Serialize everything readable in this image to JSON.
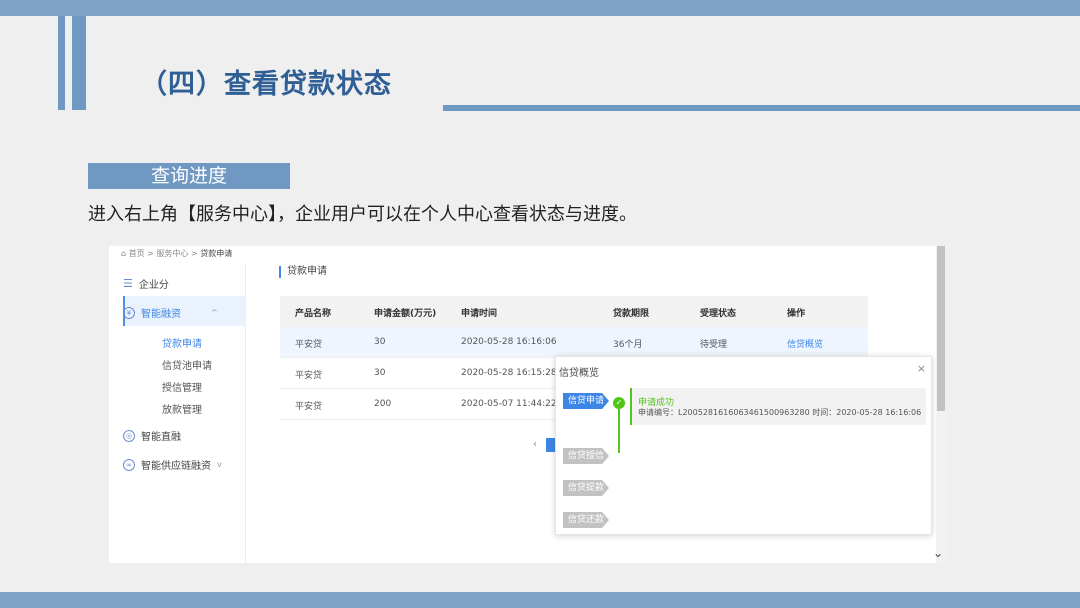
{
  "slide": {
    "title": "（四）查看贷款状态",
    "section": "查询进度",
    "description": "进入右上角【服务中心】，企业用户可以在个人中心查看状态与进度。"
  },
  "breadcrumb": {
    "home": "首页",
    "sep": ">",
    "service": "服务中心",
    "current": "贷款申请"
  },
  "sidebar": {
    "items": [
      {
        "label": "企业分"
      },
      {
        "label": "智能融资"
      },
      {
        "label": "智能直融"
      },
      {
        "label": "智能供应链融资"
      }
    ],
    "sub_items": [
      {
        "label": "贷款申请"
      },
      {
        "label": "信贷池申请"
      },
      {
        "label": "授信管理"
      },
      {
        "label": "放款管理"
      }
    ]
  },
  "panel": {
    "title": "贷款申请"
  },
  "table": {
    "headers": [
      "产品名称",
      "申请金额(万元)",
      "申请时间",
      "贷款期限",
      "受理状态",
      "操作"
    ],
    "rows": [
      [
        "平安贷",
        "30",
        "2020-05-28 16:16:06",
        "36个月",
        "待受理",
        "信贷概览"
      ],
      [
        "平安贷",
        "30",
        "2020-05-28 16:15:28",
        "",
        "",
        ""
      ],
      [
        "平安贷",
        "200",
        "2020-05-07 11:44:22",
        "",
        "",
        ""
      ]
    ]
  },
  "pager": {
    "prev": "‹"
  },
  "popup": {
    "title": "信贷概览",
    "close": "×",
    "steps": [
      {
        "label": "信贷申请",
        "state": "active"
      },
      {
        "label": "信贷授信",
        "state": "idle"
      },
      {
        "label": "信贷提款",
        "state": "idle"
      },
      {
        "label": "信贷还款",
        "state": "idle"
      }
    ],
    "check": "✓",
    "status": "申请成功",
    "detail": "申请编号：L20052816160634615009632​80 时间：2020-05-28 16:16:06"
  },
  "scroll": {
    "down_arrow": "⌄"
  },
  "colors": {
    "accent": "#3d86e5",
    "theme": "#6f98c2",
    "success": "#52c41a"
  }
}
